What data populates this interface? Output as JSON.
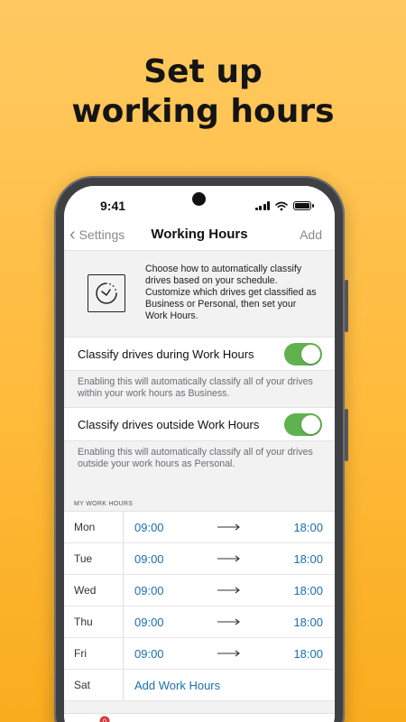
{
  "headline": {
    "line1": "Set up",
    "line2": "working hours"
  },
  "status": {
    "time": "9:41"
  },
  "nav": {
    "back_label": "Settings",
    "title": "Working Hours",
    "add_label": "Add"
  },
  "intro": {
    "icon": "clock-icon",
    "text": "Choose how to automatically classify drives based on your schedule. Customize which drives get classified as Business or Personal, then set your Work Hours."
  },
  "toggles": [
    {
      "label": "Classify drives during Work Hours",
      "enabled": true,
      "description": "Enabling this will automatically classify all of your drives within your work hours as Business."
    },
    {
      "label": "Classify drives outside Work Hours",
      "enabled": true,
      "description": "Enabling this will automatically classify all of your drives outside your work hours as Personal."
    }
  ],
  "work_hours": {
    "header": "MY WORK HOURS",
    "rows": [
      {
        "day": "Mon",
        "start": "09:00",
        "end": "18:00"
      },
      {
        "day": "Tue",
        "start": "09:00",
        "end": "18:00"
      },
      {
        "day": "Wed",
        "start": "09:00",
        "end": "18:00"
      },
      {
        "day": "Thu",
        "start": "09:00",
        "end": "18:00"
      },
      {
        "day": "Fri",
        "start": "09:00",
        "end": "18:00"
      }
    ],
    "sat": {
      "day": "Sat",
      "action": "Add Work Hours"
    }
  },
  "tabbar": {
    "badge": "0",
    "icons": [
      "drives-icon",
      "reports-icon",
      "vehicle-icon",
      "settings-icon"
    ]
  },
  "colors": {
    "background": "#ffbb3c",
    "toggle_on": "#60b24f",
    "link": "#1a6fae"
  }
}
